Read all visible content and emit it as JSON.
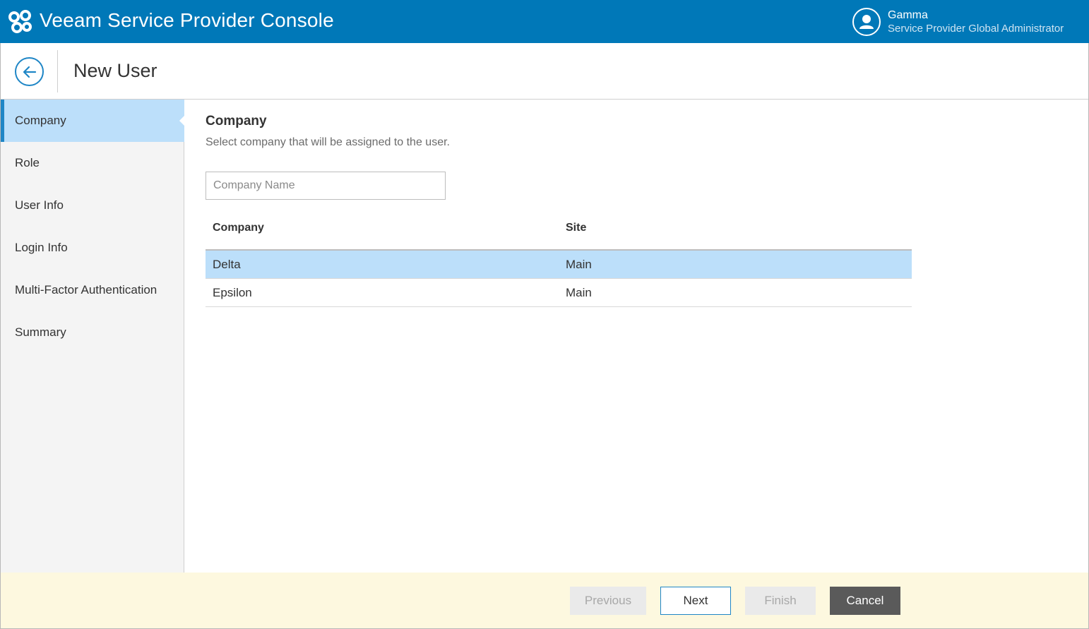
{
  "app": {
    "title": "Veeam Service Provider Console",
    "logo_icon": "veeam-logo-icon"
  },
  "user": {
    "name": "Gamma",
    "role": "Service Provider Global Administrator",
    "avatar_icon": "user-avatar-icon"
  },
  "header": {
    "back_icon": "back-arrow-icon",
    "title": "New User"
  },
  "steps": [
    {
      "label": "Company",
      "active": true
    },
    {
      "label": "Role",
      "active": false
    },
    {
      "label": "User Info",
      "active": false
    },
    {
      "label": "Login Info",
      "active": false
    },
    {
      "label": "Multi-Factor Authentication",
      "active": false
    },
    {
      "label": "Summary",
      "active": false
    }
  ],
  "main": {
    "title": "Company",
    "description": "Select company that will be assigned to the user.",
    "search": {
      "placeholder": "Company Name",
      "value": ""
    },
    "table": {
      "columns": [
        "Company",
        "Site"
      ],
      "rows": [
        {
          "company": "Delta",
          "site": "Main",
          "selected": true
        },
        {
          "company": "Epsilon",
          "site": "Main",
          "selected": false
        }
      ]
    }
  },
  "footer": {
    "previous_label": "Previous",
    "next_label": "Next",
    "finish_label": "Finish",
    "cancel_label": "Cancel"
  },
  "colors": {
    "brand_blue": "#0078b8",
    "selection": "#bcdffa",
    "footer_bg": "#fdf8df",
    "cancel_bg": "#5a5a5a"
  }
}
